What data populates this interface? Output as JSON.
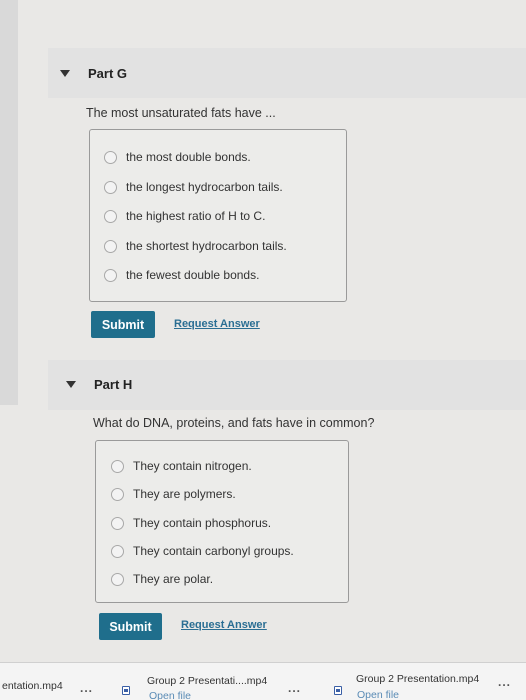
{
  "partG": {
    "title": "Part G",
    "question": "The most unsaturated fats have ...",
    "options": [
      "the most double bonds.",
      "the longest hydrocarbon tails.",
      "the highest ratio of H to C.",
      "the shortest hydrocarbon tails.",
      "the fewest double bonds."
    ],
    "submit_label": "Submit",
    "request_label": "Request Answer"
  },
  "partH": {
    "title": "Part H",
    "question": "What do DNA, proteins, and fats have in common?",
    "options": [
      "They contain nitrogen.",
      "They are polymers.",
      "They contain phosphorus.",
      "They contain carbonyl groups.",
      "They are polar."
    ],
    "submit_label": "Submit",
    "request_label": "Request Answer"
  },
  "downloads": [
    {
      "name": "entation.mp4",
      "sub": "",
      "icon": "file-icon"
    },
    {
      "name": "Group 2 Presentati....mp4",
      "sub": "Open file",
      "icon": "file-icon"
    },
    {
      "name": "Group 2 Presentation.mp4",
      "sub": "Open file",
      "icon": "file-icon"
    }
  ],
  "more_label": "...",
  "colors": {
    "submit_bg": "#1f6e8c",
    "link": "#2a6e93",
    "page_bg": "#e9e8e6"
  }
}
